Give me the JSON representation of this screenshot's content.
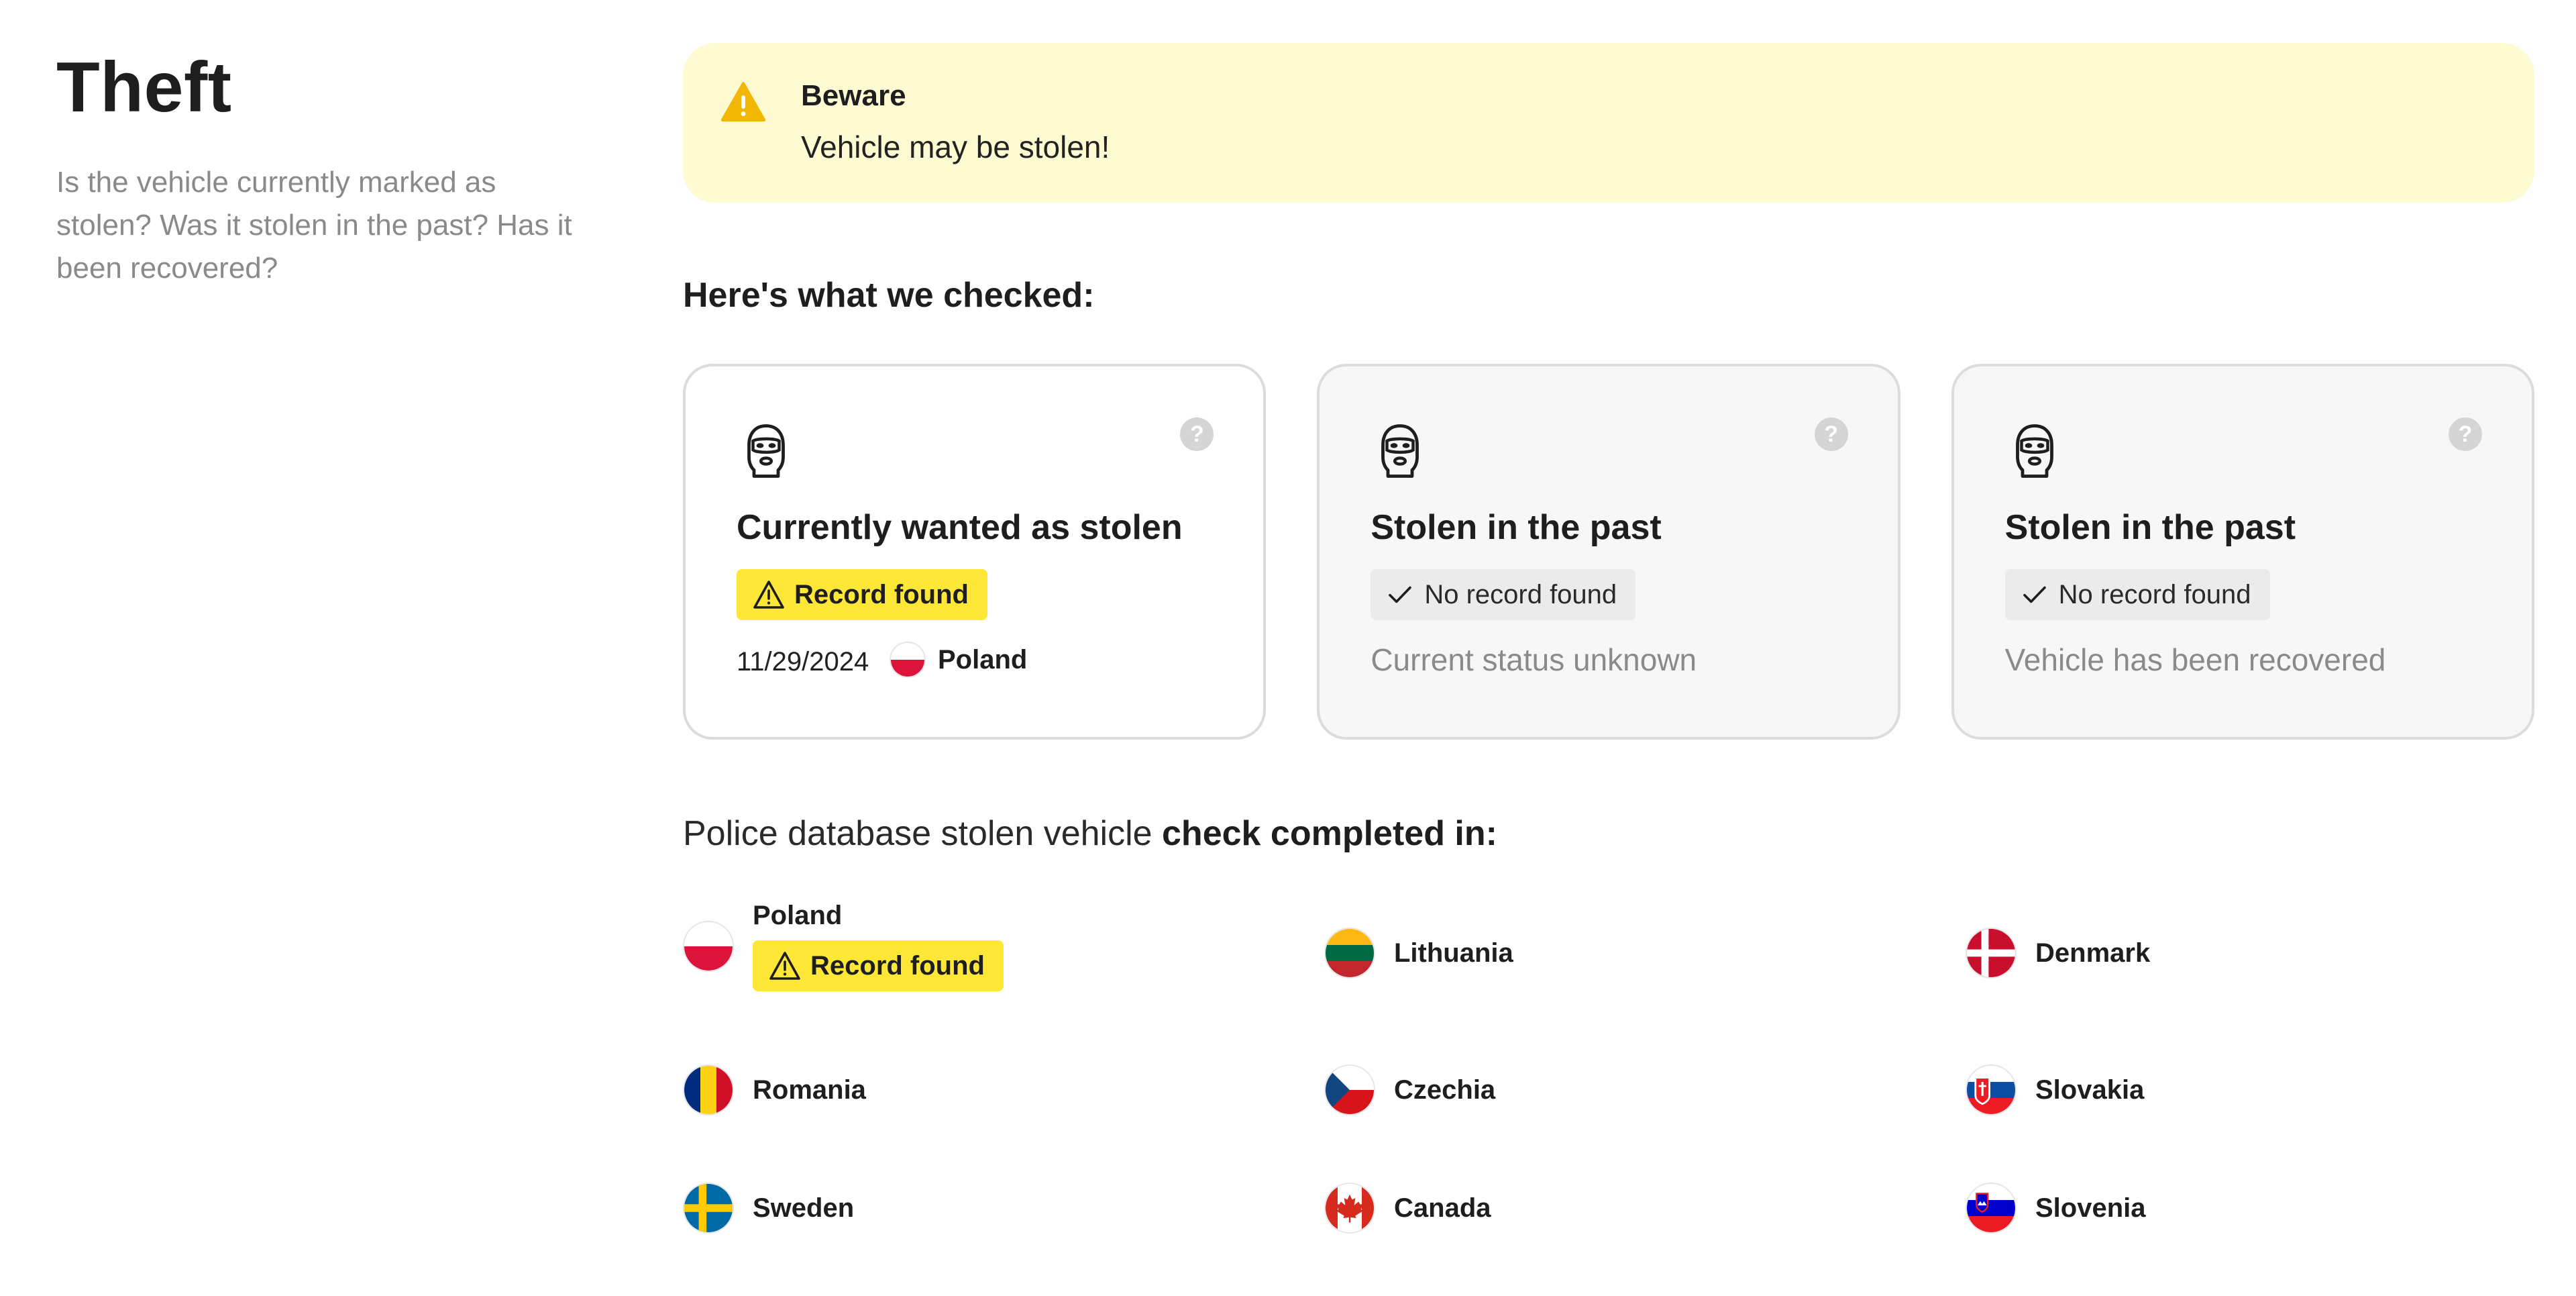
{
  "sidebar": {
    "title": "Theft",
    "description": "Is the vehicle currently marked as stolen? Was it stolen in the past? Has it been recovered?"
  },
  "alert": {
    "title": "Beware",
    "text": "Vehicle may be stolen!",
    "icon": "warning-icon",
    "bg_color": "#fefbd2",
    "icon_color": "#f2b705"
  },
  "checked": {
    "title": "Here's what we checked:",
    "cards": [
      {
        "title": "Currently wanted as stolen",
        "status": "Record found",
        "date": "11/29/2024",
        "country": "Poland"
      },
      {
        "title": "Stolen in the past",
        "status": "No record found",
        "subtext": "Current status unknown"
      },
      {
        "title": "Stolen in the past",
        "status": "No record found",
        "subtext": "Vehicle has been recovered"
      }
    ]
  },
  "database": {
    "title_prefix": "Police database stolen vehicle ",
    "title_bold": "check completed in:",
    "countries": [
      {
        "name": "Poland",
        "status": "Record found"
      },
      {
        "name": "Lithuania"
      },
      {
        "name": "Denmark"
      },
      {
        "name": "Romania"
      },
      {
        "name": "Czechia"
      },
      {
        "name": "Slovakia"
      },
      {
        "name": "Sweden"
      },
      {
        "name": "Canada"
      },
      {
        "name": "Slovenia"
      }
    ]
  },
  "colors": {
    "record_found_badge": "#ffe737",
    "no_record_badge": "#ebebeb",
    "muted_text": "#8a8a8a"
  }
}
